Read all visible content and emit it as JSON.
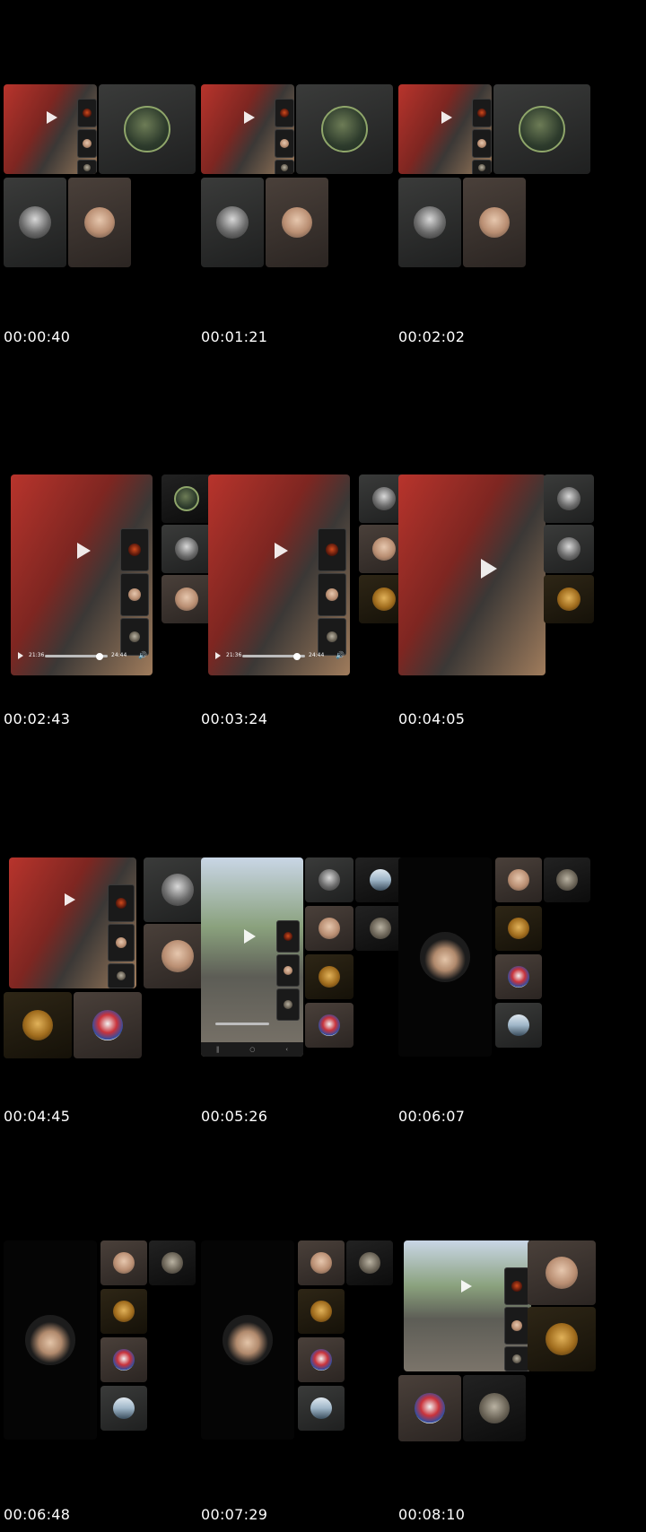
{
  "timestamps": [
    "00:00:40",
    "00:01:21",
    "00:02:02",
    "00:02:43",
    "00:03:24",
    "00:04:05",
    "00:04:45",
    "00:05:26",
    "00:06:07",
    "00:06:48",
    "00:07:29",
    "00:08:10"
  ],
  "player": {
    "elapsed": "21:36",
    "total": "24:44",
    "progress": 0.87
  },
  "colors": {
    "background": "#000000",
    "timestamp_text": "#ffffff"
  },
  "icons": {
    "play": "play-icon",
    "volume": "volume-icon"
  }
}
